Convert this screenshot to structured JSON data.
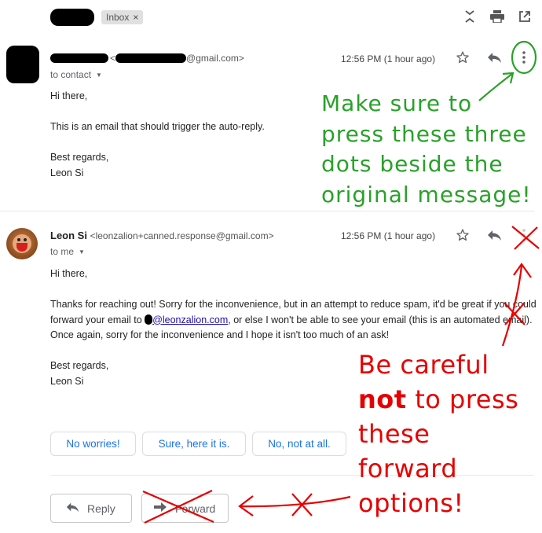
{
  "header": {
    "label_chip": "Inbox",
    "label_chip_close": "×",
    "icons": [
      "collapse-icon",
      "print-icon",
      "open-new-window-icon"
    ]
  },
  "message1": {
    "sender_email_suffix": "@gmail.com>",
    "address_open": "<",
    "to_line": "to contact",
    "time": "12:56 PM (1 hour ago)",
    "body": [
      "Hi there,",
      "This is an email that should trigger the auto-reply.",
      "Best regards,",
      "Leon Si"
    ]
  },
  "message2": {
    "sender_name": "Leon Si",
    "sender_address": "<leonzalion+canned.response@gmail.com>",
    "to_line": "to me",
    "time": "12:56 PM (1 hour ago)",
    "greeting": "Hi there,",
    "para_before_link": "Thanks for reaching out! Sorry for the inconvenience, but in an attempt to reduce spam, it'd be great if you could forward your email to ",
    "link_text": "@leonzalion.com",
    "para_after_link": ", or else I won't be able to see your email (this is an automated email). Once again, sorry for the inconvenience and I hope it isn't too much of an ask!",
    "signoff": "Best regards,",
    "signature": "Leon Si"
  },
  "smart_replies": [
    "No worries!",
    "Sure, here it is.",
    "No, not at all."
  ],
  "actions": {
    "reply": "Reply",
    "forward": "Forward"
  },
  "annotations": {
    "green_lines": [
      "Make sure to",
      "press these three",
      "dots beside the",
      "original message!"
    ],
    "red_line1": "Be careful",
    "red_line2_bold": "not",
    "red_line2_rest": " to press",
    "red_lines_rest": [
      "these",
      "forward",
      "options!"
    ]
  },
  "colors": {
    "annotation_green": "#2aa12a",
    "annotation_red": "#e60000",
    "link_blue": "#1a0dab",
    "chip_blue": "#1a73e8"
  }
}
